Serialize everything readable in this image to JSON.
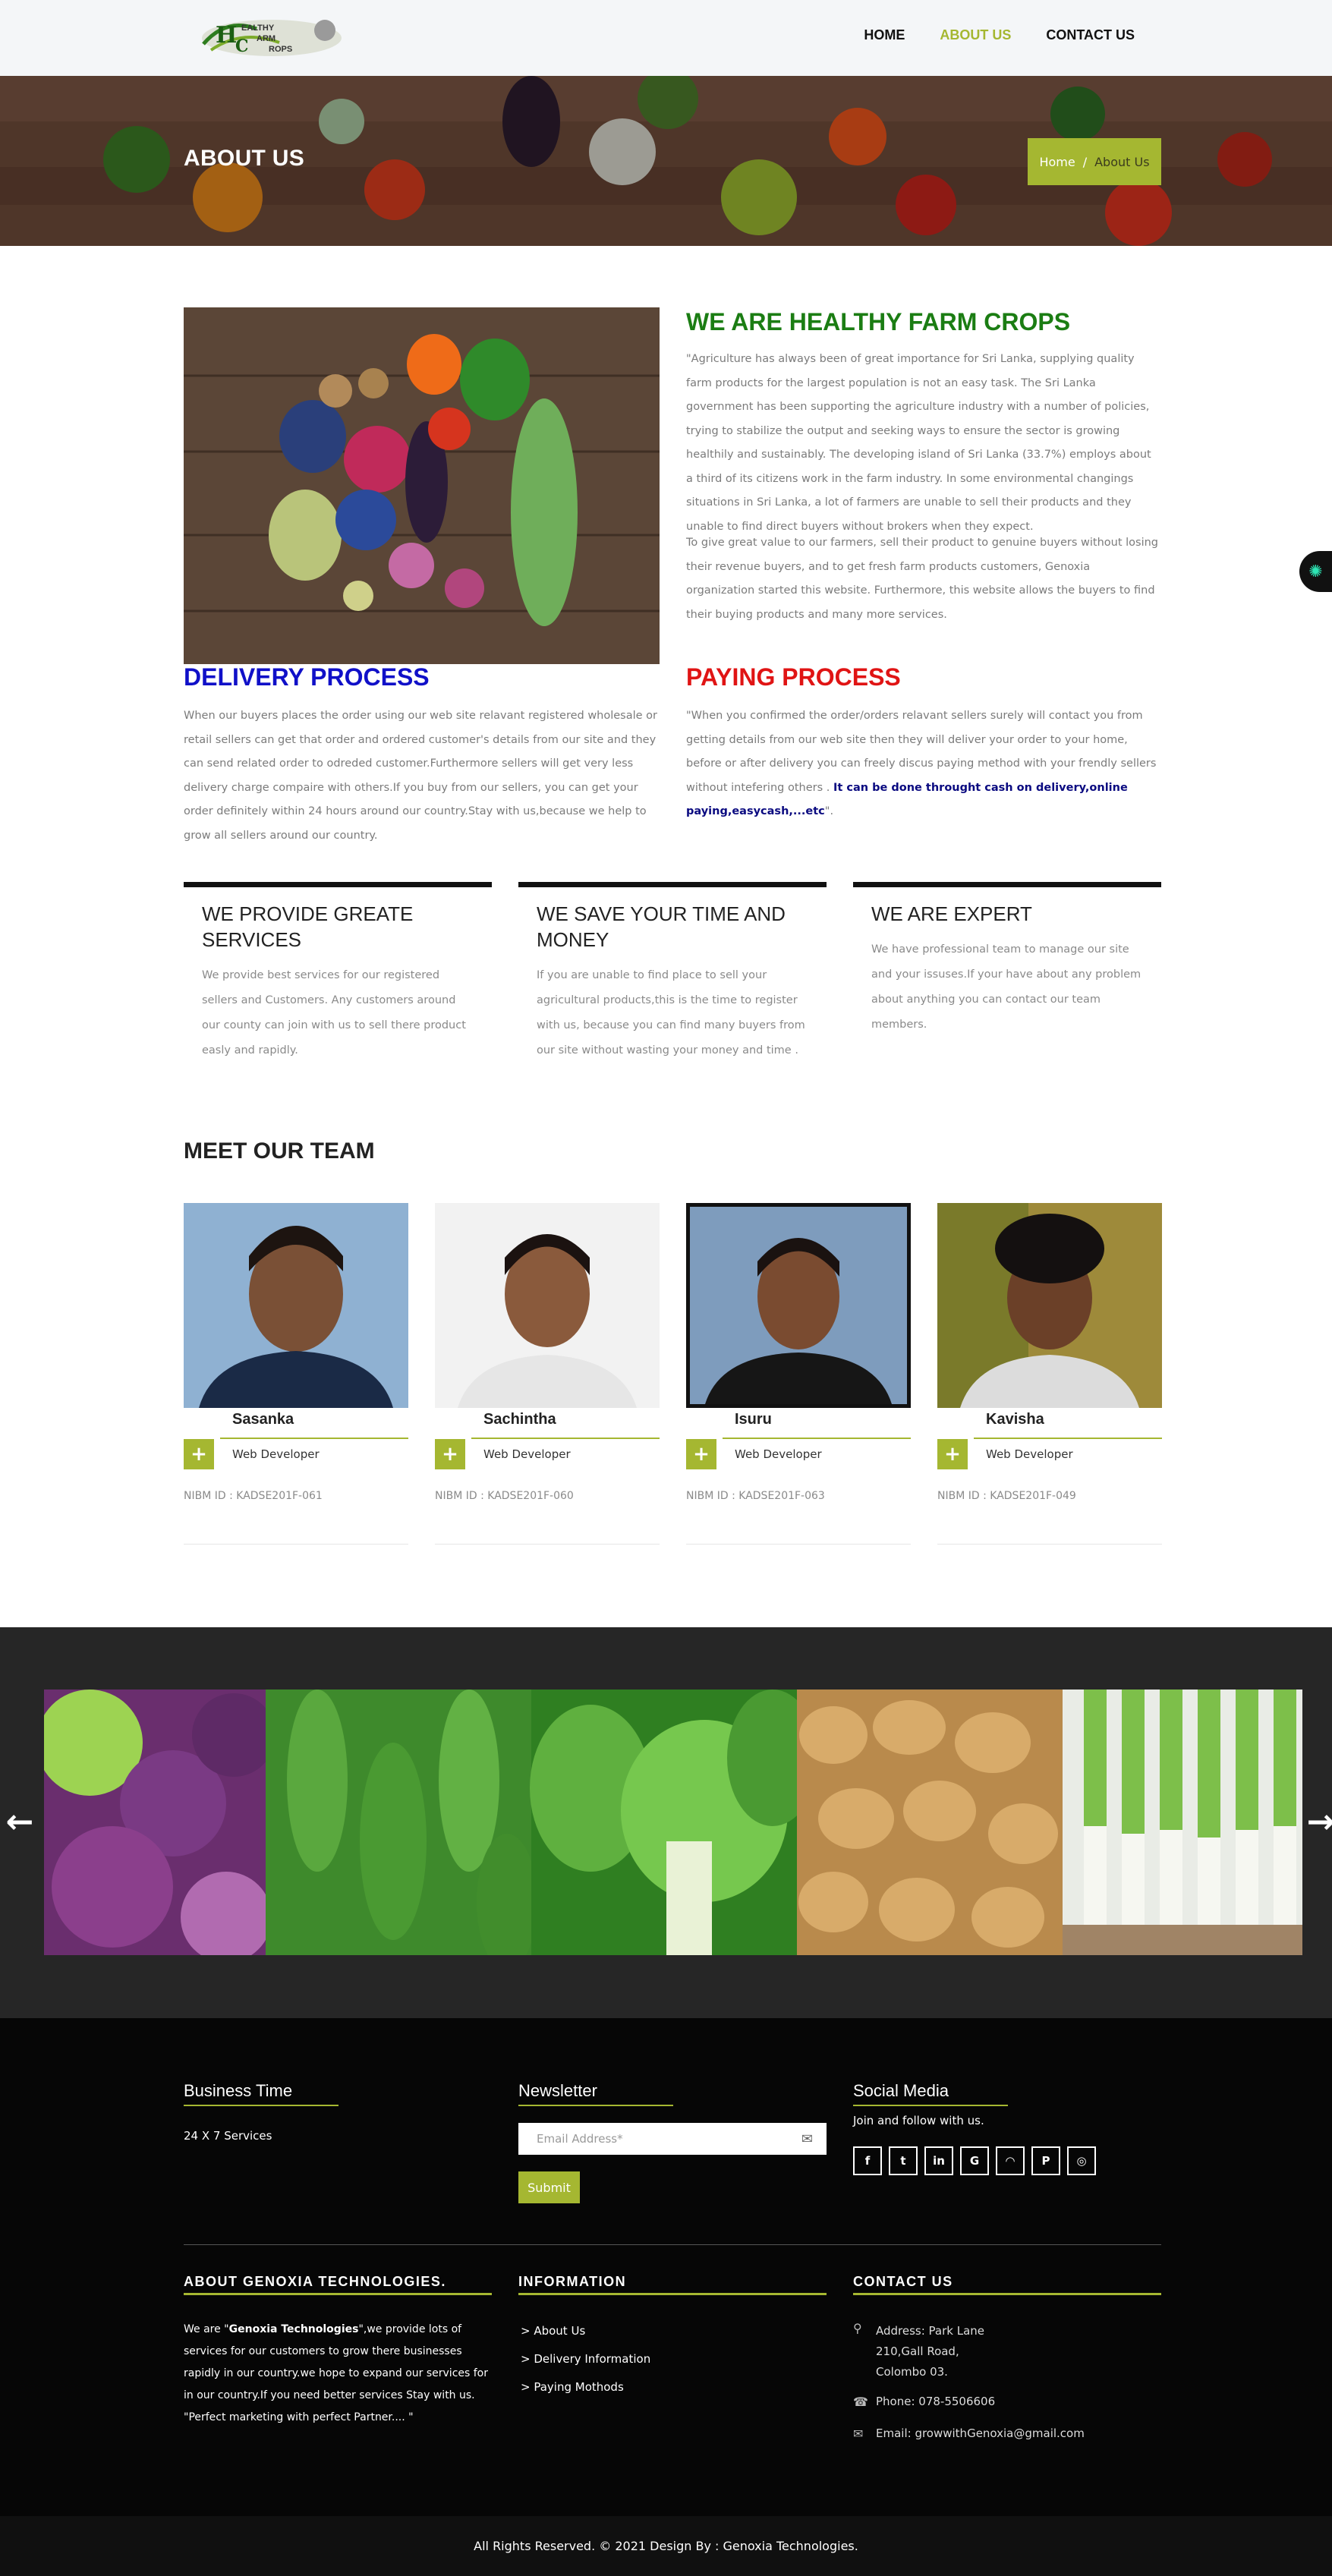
{
  "header": {
    "logo_alt": "Healthy Farm Crops",
    "nav": [
      {
        "label": "HOME",
        "active": false
      },
      {
        "label": "ABOUT US",
        "active": true
      },
      {
        "label": "CONTACT US",
        "active": false
      }
    ]
  },
  "banner": {
    "title": "ABOUT US",
    "breadcrumb_home": "Home",
    "breadcrumb_sep": "/",
    "breadcrumb_current": "About Us"
  },
  "intro": {
    "title": "WE ARE HEALTHY FARM CROPS",
    "p1": "\"Agriculture has always been of great importance for Sri Lanka, supplying quality farm products for the largest population is not an easy task. The Sri Lanka government has been supporting the agriculture industry with a number of policies, trying to stabilize the output and seeking ways to ensure the sector is growing healthily and sustainably. The developing island of Sri Lanka (33.7%) employs about a third of its citizens work in the farm industry. In some environmental changings situations in Sri Lanka, a lot of farmers are unable to sell their products and they unable to find direct buyers without brokers when they expect.",
    "p2": "To give great value to our farmers, sell their product to genuine buyers without losing their revenue buyers, and to get fresh farm products customers, Genoxia organization started this website. Furthermore, this website allows the buyers to find their buying products and many more services."
  },
  "delivery": {
    "title": "DELIVERY PROCESS",
    "text": "When our buyers places the order using our web site relavant registered wholesale or retail sellers can get that order and ordered customer's details from our site and they can send related order to odreded customer.Furthermore sellers will get very less delivery charge compaire with others.If you buy from our sellers, you can get your order definitely within 24 hours around our country.Stay with us,because we help to grow all sellers around our country."
  },
  "paying": {
    "title": "PAYING PROCESS",
    "text": "\"When you confirmed the order/orders relavant sellers surely will contact you from getting details from our web site then they will deliver your order to your home, before or after delivery you can freely discus paying method with your frendly sellers without intefering others . ",
    "bold": "It can be done throught cash on delivery,online paying,easycash,...etc",
    "end": "\"."
  },
  "services": [
    {
      "title": "WE PROVIDE GREATE SERVICES",
      "text": "We provide best services for our registered sellers and Customers. Any customers around our county can join with us to sell there product easly and rapidly."
    },
    {
      "title": "WE SAVE YOUR TIME AND MONEY",
      "text": "If you are unable to find place to sell your agricultural products,this is the time to register with us, because you can find many buyers from our site without wasting your money and time ."
    },
    {
      "title": "WE ARE EXPERT",
      "text": "We have professional team to manage our site and your issuses.If your have about any problem about anything you can contact our team members."
    }
  ],
  "team": {
    "title": "MEET OUR TEAM",
    "members": [
      {
        "name": "Sasanka",
        "role": "Web Developer",
        "nibm": "NIBM ID : KADSE201F-061"
      },
      {
        "name": "Sachintha",
        "role": "Web Developer",
        "nibm": "NIBM ID : KADSE201F-060"
      },
      {
        "name": "Isuru",
        "role": "Web Developer",
        "nibm": "NIBM ID : KADSE201F-063"
      },
      {
        "name": "Kavisha",
        "role": "Web Developer",
        "nibm": "NIBM ID : KADSE201F-049"
      }
    ]
  },
  "carousel": {
    "prev": "←",
    "next": "→"
  },
  "footer": {
    "business_title": "Business Time",
    "business_text": "24 X 7 Services",
    "newsletter_title": "Newsletter",
    "email_placeholder": "Email Address*",
    "submit": "Submit",
    "social_title": "Social Media",
    "social_text": "Join and follow with us.",
    "social_icons": [
      "facebook-icon",
      "twitter-icon",
      "linkedin-icon",
      "google-plus-icon",
      "rss-icon",
      "pinterest-icon",
      "whatsapp-icon"
    ],
    "about_title": "ABOUT GENOXIA TECHNOLOGIES.",
    "about_pre": "We are \"",
    "about_bold": "Genoxia Technologies",
    "about_post": "\",we provide lots of services for our customers to grow there businesses rapidly in our country.we hope to expand our services for in our country.If you need better services Stay with us. \"Perfect marketing with perfect Partner.... \"",
    "info_title": "INFORMATION",
    "info_links": [
      "About Us",
      "Delivery Information",
      "Paying Mothods"
    ],
    "contact_title": "CONTACT US",
    "address_label": "Address: Park Lane",
    "address_line2": "210,Gall Road,",
    "address_line3": "Colombo 03.",
    "phone": "Phone: 078-5506606",
    "email": "Email: growwithGenoxia@gmail.com",
    "copyright": "All Rights Reserved. © 2021 Design By : Genoxia Technologies."
  }
}
